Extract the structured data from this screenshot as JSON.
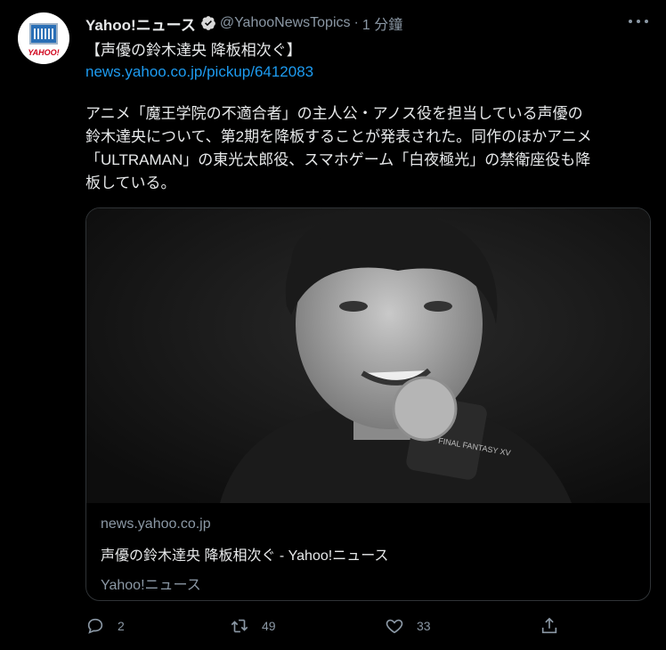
{
  "account": {
    "display_name": "Yahoo!ニュース",
    "handle": "@YahooNewsTopics",
    "separator": "·",
    "time": "1 分鐘",
    "avatar_brand": "YAHOO!"
  },
  "tweet": {
    "headline": "【声優の鈴木達央 降板相次ぐ】",
    "link": "news.yahoo.co.jp/pickup/6412083",
    "body_lines": [
      "アニメ「魔王学院の不適合者」の主人公・アノス役を担当している声優の",
      "鈴木達央について、第2期を降板することが発表された。同作のほかアニメ",
      "「ULTRAMAN」の東光太郎役、スマホゲーム「白夜極光」の禁衛座役も降",
      "板している。"
    ]
  },
  "card": {
    "domain": "news.yahoo.co.jp",
    "title": "声優の鈴木達央 降板相次ぐ - Yahoo!ニュース",
    "source": "Yahoo!ニュース",
    "photo_caption": "FINAL FANTASY XV"
  },
  "actions": {
    "reply_count": "2",
    "retweet_count": "49",
    "like_count": "33"
  },
  "colors": {
    "background": "#000000",
    "text": "#e7e9ea",
    "secondary": "#8b98a5",
    "link": "#1d9bf0",
    "border": "#2f3336"
  },
  "icons": [
    "verified-badge-icon",
    "more-icon",
    "reply-icon",
    "retweet-icon",
    "like-icon",
    "share-icon"
  ]
}
